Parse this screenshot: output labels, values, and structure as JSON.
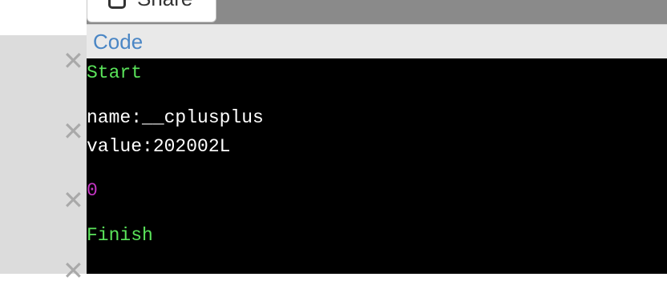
{
  "toolbar": {
    "share_label": "Share",
    "share_icon": "share-icon"
  },
  "panel": {
    "title": "Code"
  },
  "close_glyph": "✕",
  "output": {
    "start": "Start",
    "name_line": "name:__cplusplus",
    "value_line": "value:202002L",
    "result": "0",
    "finish": "Finish"
  },
  "colors": {
    "accent": "#4a86c5",
    "terminal_bg": "#000000",
    "green": "#5ae35a",
    "magenta": "#c436c4"
  }
}
